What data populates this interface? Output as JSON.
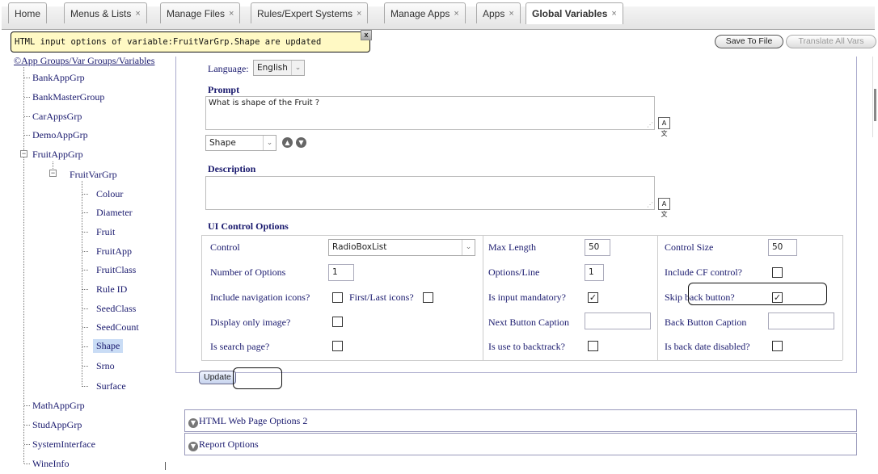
{
  "tabs": [
    {
      "label": "Home",
      "closable": false
    },
    {
      "label": "Menus & Lists",
      "closable": true
    },
    {
      "label": "Manage Files",
      "closable": true
    },
    {
      "label": "Rules/Expert Systems",
      "closable": true
    },
    {
      "label": "Manage Apps",
      "closable": true
    },
    {
      "label": "Apps",
      "closable": true
    },
    {
      "label": "Global Variables",
      "closable": true,
      "active": true
    }
  ],
  "close_glyph": "×",
  "notification": {
    "message": "HTML input options of variable:FruitVarGrp.Shape are updated",
    "close_label": "x"
  },
  "toolbar": {
    "save_label": "Save To File",
    "translate_label": "Translate All Vars"
  },
  "tree": {
    "root_label": "App Groups/Var Groups/Variables",
    "root_glyph": "©",
    "groups": [
      "BankAppGrp",
      "BankMasterGroup",
      "CarAppsGrp",
      "DemoAppGrp",
      "FruitAppGrp"
    ],
    "var_group": "FruitVarGrp",
    "variables": [
      "Colour",
      "Diameter",
      "Fruit",
      "FruitApp",
      "FruitClass",
      "Rule ID",
      "SeedClass",
      "SeedCount",
      "Shape",
      "Srno",
      "Surface"
    ],
    "selected": "Shape",
    "groups_after": [
      "MathAppGrp",
      "StudAppGrp",
      "SystemInterface",
      "WineInfo"
    ]
  },
  "form": {
    "language_label": "Language:",
    "language_value": "English",
    "prompt_heading": "Prompt",
    "prompt_value": "What is shape of the Fruit ?",
    "field_select_value": "Shape",
    "description_heading": "Description",
    "description_value": "",
    "ui_options_heading": "UI Control Options",
    "control_label": "Control",
    "control_value": "RadioBoxList",
    "max_length_label": "Max Length",
    "max_length_value": "50",
    "control_size_label": "Control Size",
    "control_size_value": "50",
    "num_options_label": "Number of Options",
    "num_options_value": "1",
    "options_line_label": "Options/Line",
    "options_line_value": "1",
    "include_cf_label": "Include CF control?",
    "include_cf_checked": false,
    "nav_icons_label": "Include navigation icons?",
    "nav_icons_checked": false,
    "first_last_label": "First/Last icons?",
    "first_last_checked": false,
    "mandatory_label": "Is input mandatory?",
    "mandatory_checked": true,
    "skip_back_label": "Skip back button?",
    "skip_back_checked": true,
    "display_image_label": "Display only image?",
    "display_image_checked": false,
    "next_caption_label": "Next Button Caption",
    "next_caption_value": "",
    "back_caption_label": "Back Button Caption",
    "back_caption_value": "",
    "search_page_label": "Is search page?",
    "search_page_checked": false,
    "backtrack_label": "Is use to backtrack?",
    "backtrack_checked": false,
    "back_date_label": "Is back date disabled?",
    "back_date_checked": false,
    "update_label": "Update"
  },
  "sections": {
    "html_web_label": "HTML Web Page Options 2",
    "report_label": "Report Options"
  },
  "icons": {
    "check_glyph": "✓",
    "chevron_glyph": "⌄",
    "collapse_glyph": "−",
    "up_glyph": "▲",
    "down_glyph": "▼",
    "expand_glyph": "▼",
    "translate_glyph": "A文",
    "resize_glyph": "⋰"
  }
}
